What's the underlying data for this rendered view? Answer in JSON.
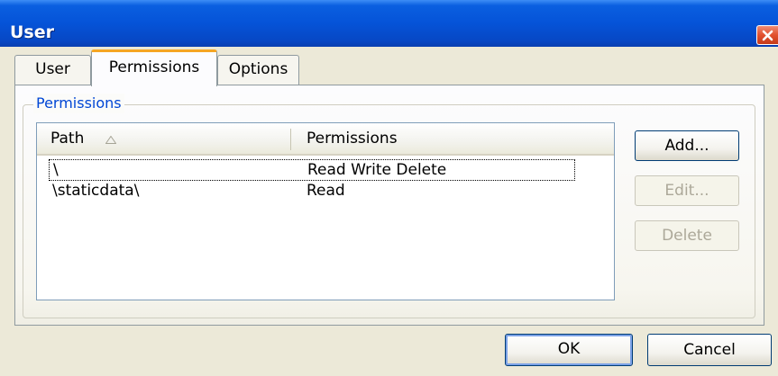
{
  "window": {
    "title": "User",
    "close_icon": "close-icon"
  },
  "tabs": [
    {
      "label": "User"
    },
    {
      "label": "Permissions",
      "selected": true
    },
    {
      "label": "Options"
    }
  ],
  "group": {
    "label": "Permissions"
  },
  "list": {
    "columns": [
      "Path",
      "Permissions"
    ],
    "sort_icon": "sort-ascending-icon",
    "rows": [
      {
        "path": "\\",
        "permissions": "Read Write Delete"
      },
      {
        "path": "\\staticdata\\",
        "permissions": "Read"
      }
    ]
  },
  "buttons": {
    "add": "Add...",
    "edit": "Edit...",
    "delete": "Delete",
    "ok": "OK",
    "cancel": "Cancel"
  },
  "colors": {
    "titlebar": "#0553d8",
    "group_label": "#0046d5",
    "tab_highlight": "#f5a623",
    "close_button": "#e2502e",
    "disabled_text": "#aca899"
  }
}
